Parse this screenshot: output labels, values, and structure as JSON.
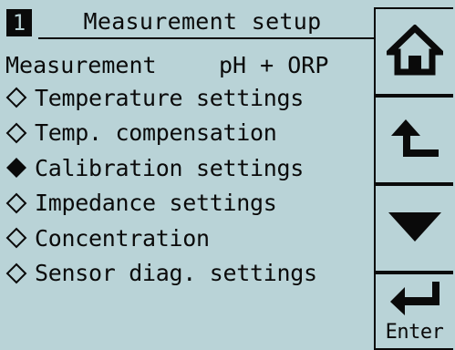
{
  "header": {
    "number": "1",
    "title": "Measurement setup"
  },
  "measurement": {
    "label": "Measurement",
    "value": "pH + ORP"
  },
  "menu": {
    "items": [
      {
        "label": "Temperature settings",
        "selected": false
      },
      {
        "label": "Temp. compensation",
        "selected": false
      },
      {
        "label": "Calibration settings",
        "selected": true
      },
      {
        "label": "Impedance settings",
        "selected": false
      },
      {
        "label": "Concentration",
        "selected": false
      },
      {
        "label": "Sensor diag. settings",
        "selected": false
      }
    ]
  },
  "buttons": {
    "home_icon": "home-icon",
    "back_icon": "return-up-arrow-icon",
    "down_icon": "down-triangle-icon",
    "enter_icon": "enter-arrow-icon",
    "enter_label": "Enter"
  },
  "colors": {
    "background": "#b9d3d7",
    "foreground": "#0a0a0a"
  }
}
